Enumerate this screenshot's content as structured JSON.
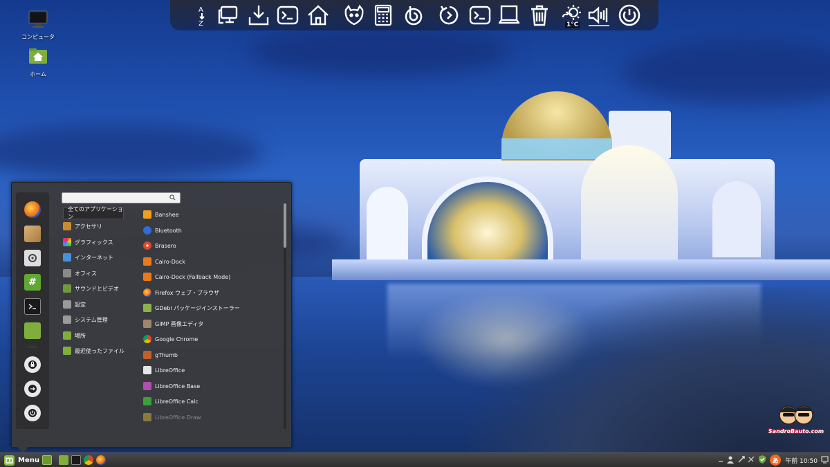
{
  "desktop": {
    "icons": [
      {
        "label": "コンピュータ",
        "icon": "computer-icon"
      },
      {
        "label": "ホーム",
        "icon": "home-folder-icon"
      }
    ]
  },
  "dock": {
    "items": [
      "sort-icon",
      "display-icon",
      "download-icon",
      "terminal-icon",
      "home-icon",
      "cat-icon",
      "calculator-icon",
      "banshee-icon",
      "update-icon",
      "terminal-icon",
      "window-icon",
      "trash-icon",
      "weather-icon",
      "volume-icon",
      "power-icon"
    ],
    "temperature": "1°C"
  },
  "menu": {
    "favorites": [
      "firefox-icon",
      "software-manager-icon",
      "system-settings-icon",
      "hash-icon",
      "terminal-icon",
      "files-icon",
      "lock-icon",
      "logout-icon",
      "shutdown-icon"
    ],
    "search": {
      "value": ""
    },
    "categories": [
      {
        "label": "全てのアプリケーション",
        "active": true
      },
      {
        "label": "アクセサリ",
        "icon": "accessories-icon",
        "color": "#c98a30"
      },
      {
        "label": "グラフィックス",
        "icon": "graphics-icon",
        "color": "#d24b9f"
      },
      {
        "label": "インターネット",
        "icon": "internet-icon",
        "color": "#4a90d9"
      },
      {
        "label": "オフィス",
        "icon": "office-icon",
        "color": "#8a8a8a"
      },
      {
        "label": "サウンドとビデオ",
        "icon": "sound-video-icon",
        "color": "#6e9a3a"
      },
      {
        "label": "設定",
        "icon": "settings-icon",
        "color": "#9a9a9a"
      },
      {
        "label": "システム管理",
        "icon": "system-admin-icon",
        "color": "#9a9a9a"
      },
      {
        "label": "場所",
        "icon": "folder-icon",
        "color": "#7fae3c"
      },
      {
        "label": "最近使ったファイル",
        "icon": "folder-recent-icon",
        "color": "#7fae3c"
      }
    ],
    "applications": [
      {
        "label": "Banshee",
        "icon": "banshee-icon",
        "color": "#f0a020"
      },
      {
        "label": "Bluetooth",
        "icon": "bluetooth-icon",
        "color": "#2f6ed0"
      },
      {
        "label": "Brasero",
        "icon": "brasero-icon",
        "color": "#d84a2a"
      },
      {
        "label": "Cairo-Dock",
        "icon": "cairo-dock-icon",
        "color": "#e87a1c"
      },
      {
        "label": "Cairo-Dock (Fallback Mode)",
        "icon": "cairo-dock-icon",
        "color": "#e87a1c"
      },
      {
        "label": "Firefox ウェブ・ブラウザ",
        "icon": "firefox-icon",
        "color": "#e8661a"
      },
      {
        "label": "GDebi パッケージインストーラー",
        "icon": "gdebi-icon",
        "color": "#8ab44a"
      },
      {
        "label": "GIMP 画像エディタ",
        "icon": "gimp-icon",
        "color": "#a0866a"
      },
      {
        "label": "Google Chrome",
        "icon": "chrome-icon",
        "color": "#3fa046"
      },
      {
        "label": "gThumb",
        "icon": "gthumb-icon",
        "color": "#c0602a"
      },
      {
        "label": "LibreOffice",
        "icon": "libreoffice-icon",
        "color": "#e6e6e6"
      },
      {
        "label": "LibreOffice Base",
        "icon": "libreoffice-base-icon",
        "color": "#b04fb0"
      },
      {
        "label": "LibreOffice Calc",
        "icon": "libreoffice-calc-icon",
        "color": "#3aa03a"
      },
      {
        "label": "LibreOffice Draw",
        "icon": "libreoffice-draw-icon",
        "color": "#d8b020"
      }
    ]
  },
  "panel": {
    "menu_label": "Menu",
    "launchers": [
      "show-desktop-icon",
      "files-icon",
      "terminal-icon",
      "chrome-icon",
      "firefox-icon"
    ],
    "tray": [
      "user-icon",
      "network-icon",
      "shield-icon",
      "update-icon"
    ],
    "ime_label": "あ",
    "clock": "午前 10:50"
  },
  "watermark": {
    "text": "SandroBauto.com"
  }
}
